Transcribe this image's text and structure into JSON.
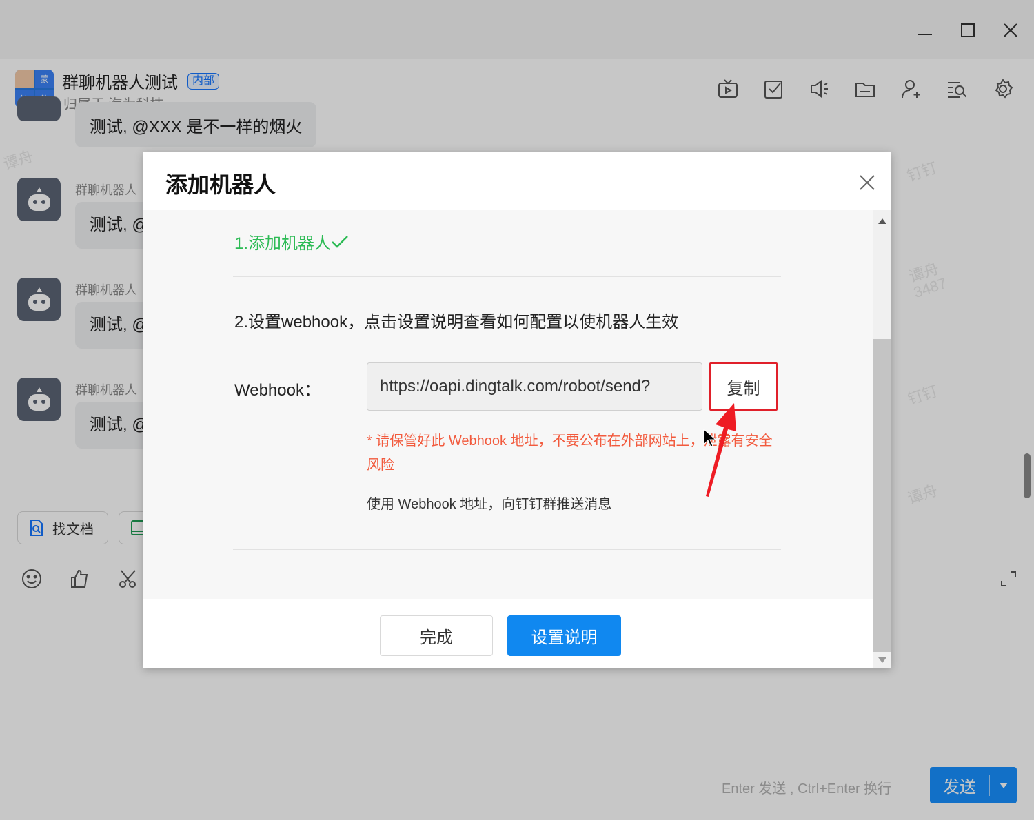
{
  "group": {
    "avatar_chars": [
      "蒙",
      "锦",
      "静"
    ],
    "title": "群聊机器人测试",
    "tag": "内部",
    "subtitle": "归属于 海为科技"
  },
  "toolbar_icons": [
    "live-icon",
    "todo-icon",
    "voice-icon",
    "folder-icon",
    "add-member-icon",
    "search-chat-icon",
    "settings-icon"
  ],
  "chat": {
    "top_bubble": "测试, @XXX 是不一样的烟火",
    "messages": [
      {
        "name": "群聊机器人",
        "text": "测试, @"
      },
      {
        "name": "群聊机器人",
        "text": "测试, @"
      },
      {
        "name": "群聊机器人",
        "text": "测试, @"
      }
    ],
    "watermarks": [
      "谭舟",
      "3487",
      "钉钉"
    ]
  },
  "quick_actions": {
    "find_docs": "找文档"
  },
  "input": {
    "hint": "Enter 发送 , Ctrl+Enter 换行",
    "send_label": "发送"
  },
  "dialog": {
    "title": "添加机器人",
    "step1": "1.添加机器人",
    "step2": "2.设置webhook，点击设置说明查看如何配置以使机器人生效",
    "webhook_label": "Webhook：",
    "webhook_value": "https://oapi.dingtalk.com/robot/send?",
    "copy_label": "复制",
    "warning": "* 请保管好此 Webhook 地址，不要公布在外部网站上，泄露有安全风险",
    "usage": "使用 Webhook 地址，向钉钉群推送消息",
    "done_label": "完成",
    "help_label": "设置说明"
  },
  "colors": {
    "primary": "#1088f0",
    "success": "#2dbb55",
    "warning": "#f25a3d",
    "highlight": "#e0202a"
  }
}
